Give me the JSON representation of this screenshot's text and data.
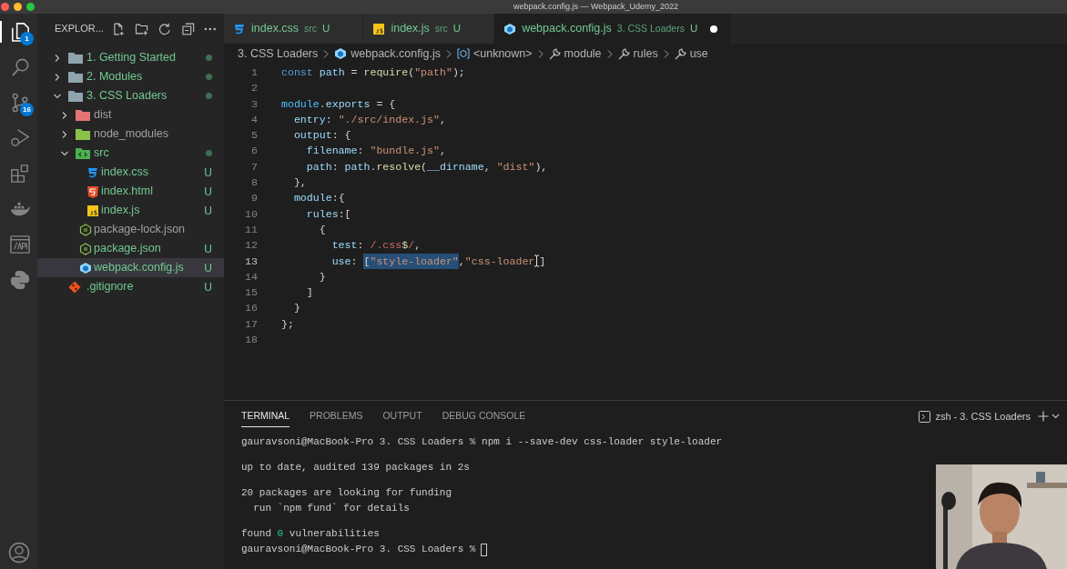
{
  "window": {
    "title": "webpack.config.js — Webpack_Udemy_2022"
  },
  "activity_bar": [
    {
      "kind": "files",
      "selected": true,
      "badge": "1"
    },
    {
      "kind": "search",
      "selected": false
    },
    {
      "kind": "source-control",
      "selected": false,
      "badge": "16"
    },
    {
      "kind": "run-debug",
      "selected": false
    },
    {
      "kind": "extensions",
      "selected": false
    },
    {
      "kind": "docker",
      "selected": false
    },
    {
      "kind": "api",
      "selected": false
    },
    {
      "kind": "python",
      "selected": false
    }
  ],
  "sidebar": {
    "title": "EXPLOR...",
    "items": [
      {
        "label": "1. Getting Started",
        "kind": "folder",
        "dimmed": false,
        "modified": true,
        "expanded": false,
        "selected": false
      },
      {
        "label": "2. Modules",
        "kind": "folder",
        "dimmed": false,
        "modified": true,
        "expanded": false,
        "selected": false
      },
      {
        "label": "3. CSS Loaders",
        "kind": "folder",
        "dimmed": false,
        "modified": true,
        "expanded": true,
        "selected": false,
        "children": [
          {
            "label": "dist",
            "kind": "folder-dist",
            "dimmed": true,
            "modified": false,
            "expanded": false,
            "selected": false
          },
          {
            "label": "node_modules",
            "kind": "folder-node",
            "dimmed": true,
            "modified": false,
            "expanded": false,
            "selected": false
          },
          {
            "label": "src",
            "kind": "folder-src",
            "dimmed": false,
            "modified": true,
            "expanded": true,
            "selected": false,
            "children": [
              {
                "label": "index.css",
                "kind": "css",
                "dimmed": false,
                "modified": false,
                "badge": "U",
                "selected": false
              },
              {
                "label": "index.html",
                "kind": "html",
                "dimmed": false,
                "modified": false,
                "badge": "U",
                "selected": false
              },
              {
                "label": "index.js",
                "kind": "js",
                "dimmed": false,
                "modified": false,
                "badge": "U",
                "selected": false
              }
            ]
          },
          {
            "label": "package-lock.json",
            "kind": "node",
            "dimmed": true,
            "modified": false,
            "selected": false
          },
          {
            "label": "package.json",
            "kind": "node",
            "dimmed": false,
            "modified": false,
            "badge": "U",
            "selected": false
          },
          {
            "label": "webpack.config.js",
            "kind": "webpack",
            "dimmed": false,
            "modified": false,
            "badge": "U",
            "selected": true
          }
        ]
      },
      {
        "label": ".gitignore",
        "kind": "git",
        "dimmed": false,
        "modified": false,
        "badge": "U",
        "selected": false
      }
    ]
  },
  "tabs": [
    {
      "label": "index.css",
      "kind": "css",
      "description": "src",
      "badge": "U",
      "selected": false,
      "dirty": false
    },
    {
      "label": "index.js",
      "kind": "js",
      "description": "src",
      "badge": "U",
      "selected": false,
      "dirty": false
    },
    {
      "label": "webpack.config.js",
      "kind": "webpack",
      "description": "3. CSS Loaders",
      "badge": "U",
      "selected": true,
      "dirty": true
    }
  ],
  "breadcrumb": [
    {
      "label": "3. CSS Loaders"
    },
    {
      "label": "webpack.config.js",
      "kind": "webpack"
    },
    {
      "label": "<unknown>",
      "kind": "variable"
    },
    {
      "label": "module",
      "kind": "wrench"
    },
    {
      "label": "rules",
      "kind": "wrench"
    },
    {
      "label": "use",
      "kind": "wrench"
    }
  ],
  "editor": {
    "lines": [
      {
        "number": "1",
        "current": false,
        "tokens": [
          {
            "kind": "keyword",
            "text": "const"
          },
          {
            "kind": "variable",
            "text": " path"
          },
          {
            "kind": "plain",
            "text": " = "
          },
          {
            "kind": "function",
            "text": "require"
          },
          {
            "kind": "plain",
            "text": "("
          },
          {
            "kind": "string",
            "text": "\"path\""
          },
          {
            "kind": "plain",
            "text": ");"
          }
        ]
      },
      {
        "number": "2",
        "current": false
      },
      {
        "number": "3",
        "current": false,
        "tokens": [
          {
            "kind": "object",
            "text": "module"
          },
          {
            "kind": "plain",
            "text": "."
          },
          {
            "kind": "variable",
            "text": "exports"
          },
          {
            "kind": "plain",
            "text": " = {"
          }
        ]
      },
      {
        "number": "4",
        "current": false,
        "tokens": [
          {
            "kind": "property",
            "text": "  entry"
          },
          {
            "kind": "plain",
            "text": ": "
          },
          {
            "kind": "string",
            "text": "\"./src/index.js\""
          },
          {
            "kind": "plain",
            "text": ","
          }
        ]
      },
      {
        "number": "5",
        "current": false,
        "tokens": [
          {
            "kind": "property",
            "text": "  output"
          },
          {
            "kind": "plain",
            "text": ": {"
          }
        ]
      },
      {
        "number": "6",
        "current": false,
        "tokens": [
          {
            "kind": "property",
            "text": "    filename"
          },
          {
            "kind": "plain",
            "text": ": "
          },
          {
            "kind": "string",
            "text": "\"bundle.js\""
          },
          {
            "kind": "plain",
            "text": ","
          }
        ]
      },
      {
        "number": "7",
        "current": false,
        "tokens": [
          {
            "kind": "property",
            "text": "    path"
          },
          {
            "kind": "plain",
            "text": ": "
          },
          {
            "kind": "variable",
            "text": "path"
          },
          {
            "kind": "plain",
            "text": "."
          },
          {
            "kind": "function",
            "text": "resolve"
          },
          {
            "kind": "plain",
            "text": "("
          },
          {
            "kind": "variable",
            "text": "__dirname"
          },
          {
            "kind": "plain",
            "text": ", "
          },
          {
            "kind": "string",
            "text": "\"dist\""
          },
          {
            "kind": "plain",
            "text": "),"
          }
        ]
      },
      {
        "number": "8",
        "current": false,
        "tokens": [
          {
            "kind": "plain",
            "text": "  },"
          }
        ]
      },
      {
        "number": "9",
        "current": false,
        "tokens": [
          {
            "kind": "property",
            "text": "  module"
          },
          {
            "kind": "plain",
            "text": ":{"
          }
        ]
      },
      {
        "number": "10",
        "current": false,
        "tokens": [
          {
            "kind": "property",
            "text": "    rules"
          },
          {
            "kind": "plain",
            "text": ":["
          }
        ]
      },
      {
        "number": "11",
        "current": false,
        "tokens": [
          {
            "kind": "plain",
            "text": "      {"
          }
        ]
      },
      {
        "number": "12",
        "current": false,
        "tokens": [
          {
            "kind": "property",
            "text": "        test"
          },
          {
            "kind": "plain",
            "text": ": "
          },
          {
            "kind": "regex",
            "text": "/.css"
          },
          {
            "kind": "regex-anchor",
            "text": "$"
          },
          {
            "kind": "regex",
            "text": "/"
          },
          {
            "kind": "plain",
            "text": ","
          }
        ]
      },
      {
        "number": "13",
        "current": true,
        "tokens": [
          {
            "kind": "property",
            "text": "        use"
          },
          {
            "kind": "plain",
            "text": ": "
          },
          {
            "kind": "selected-plain",
            "text": "["
          },
          {
            "kind": "selected-string",
            "text": "\"style-loader\""
          },
          {
            "kind": "plain",
            "text": ","
          },
          {
            "kind": "string",
            "text": "\"css-loader"
          },
          {
            "kind": "pointer"
          },
          {
            "kind": "plain",
            "text": "]"
          }
        ]
      },
      {
        "number": "14",
        "current": false,
        "tokens": [
          {
            "kind": "plain",
            "text": "      }"
          }
        ]
      },
      {
        "number": "15",
        "current": false,
        "tokens": [
          {
            "kind": "plain",
            "text": "    ]"
          }
        ]
      },
      {
        "number": "16",
        "current": false,
        "tokens": [
          {
            "kind": "plain",
            "text": "  }"
          }
        ]
      },
      {
        "number": "17",
        "current": false,
        "tokens": [
          {
            "kind": "plain",
            "text": "};"
          }
        ]
      },
      {
        "number": "18",
        "current": false
      }
    ]
  },
  "panel": {
    "tabs": [
      {
        "label": "TERMINAL",
        "selected": true
      },
      {
        "label": "PROBLEMS",
        "selected": false
      },
      {
        "label": "OUTPUT",
        "selected": false
      },
      {
        "label": "DEBUG CONSOLE",
        "selected": false
      }
    ],
    "terminal_name": "zsh - 3. CSS Loaders",
    "blocks": [
      [
        [
          {
            "kind": "plain",
            "text": "gauravsoni@MacBook-Pro 3. CSS Loaders % npm i --save-dev css-loader style-loader"
          }
        ]
      ],
      [
        [
          {
            "kind": "plain",
            "text": "up to date, audited 139 packages in 2s"
          }
        ]
      ],
      [
        [
          {
            "kind": "plain",
            "text": "20 packages are looking for funding"
          }
        ],
        [
          {
            "kind": "plain",
            "text": "  run `npm fund` for details"
          }
        ]
      ],
      [
        [
          {
            "kind": "plain",
            "text": "found "
          },
          {
            "kind": "number",
            "text": "0"
          },
          {
            "kind": "plain",
            "text": " vulnerabilities"
          }
        ],
        [
          {
            "kind": "plain",
            "text": "gauravsoni@MacBook-Pro 3. CSS Loaders %"
          },
          {
            "kind": "cursor"
          }
        ]
      ]
    ]
  }
}
